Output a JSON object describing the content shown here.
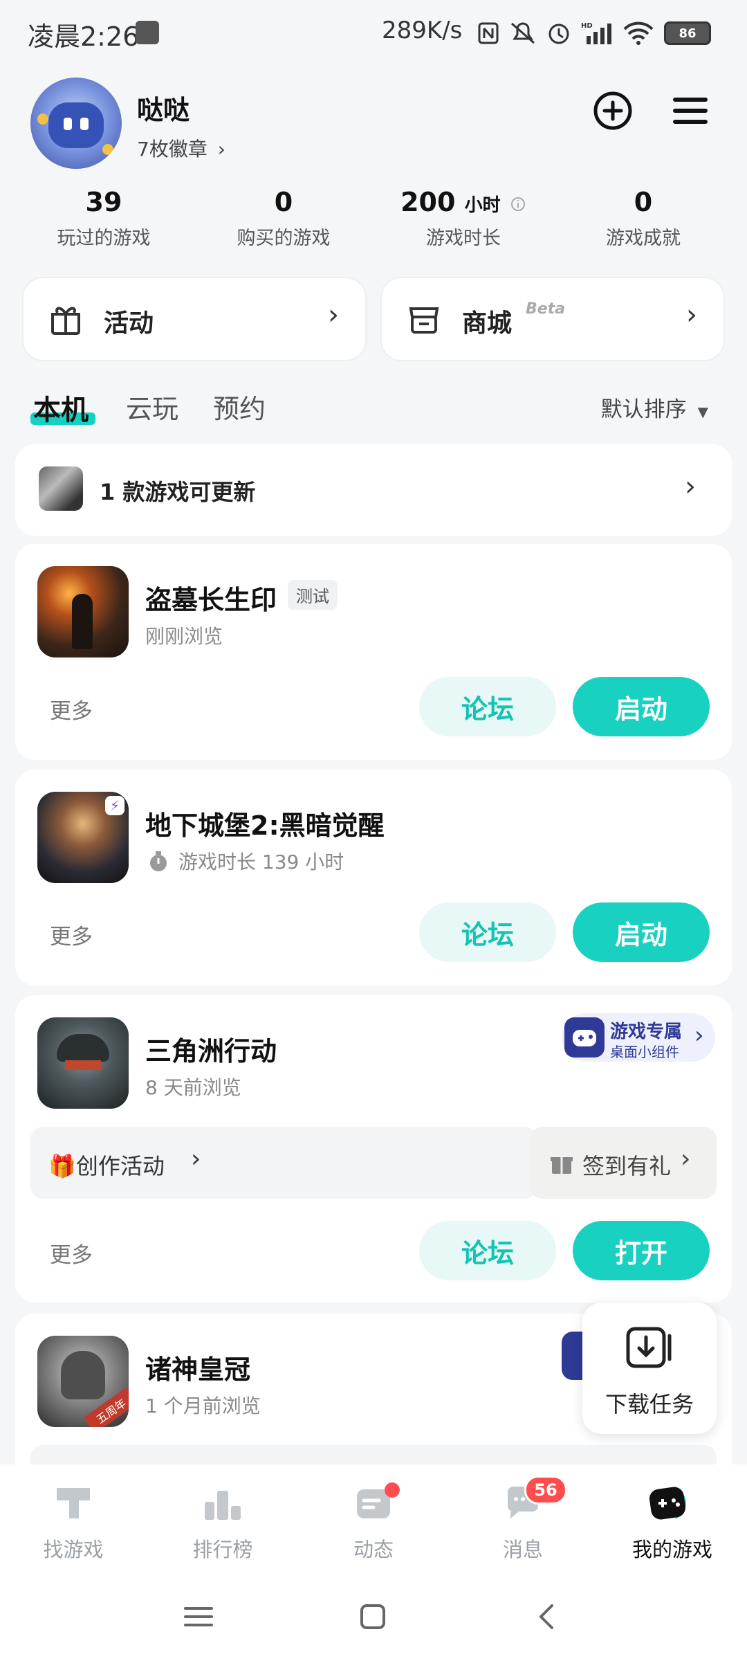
{
  "status_bar": {
    "time": "凌晨2:26",
    "net_speed": "289K/s",
    "battery": "86"
  },
  "profile": {
    "name": "哒哒",
    "badges": "7枚徽章",
    "badges_chevron": "›"
  },
  "stats": [
    {
      "value": "39",
      "unit": "",
      "label": "玩过的游戏"
    },
    {
      "value": "0",
      "unit": "",
      "label": "购买的游戏"
    },
    {
      "value": "200",
      "unit": "小时",
      "label": "游戏时长"
    },
    {
      "value": "0",
      "unit": "",
      "label": "游戏成就"
    }
  ],
  "quick_links": {
    "activity": "活动",
    "store": "商城",
    "store_tag": "Beta"
  },
  "tabs": {
    "local": "本机",
    "cloud": "云玩",
    "reserve": "预约",
    "sort": "默认排序"
  },
  "update_banner": {
    "text": "1 款游戏可更新"
  },
  "games": [
    {
      "title": "盗墓长生印",
      "tag": "测试",
      "sub": "刚刚浏览",
      "more": "更多",
      "forum": "论坛",
      "action": "启动"
    },
    {
      "title": "地下城堡2:黑暗觉醒",
      "sub": "游戏时长 139 小时",
      "more": "更多",
      "forum": "论坛",
      "action": "启动"
    },
    {
      "title": "三角洲行动",
      "sub": "8 天前浏览",
      "widget_title": "游戏专属",
      "widget_sub": "桌面小组件",
      "event": "🎁创作活动",
      "event_chevron": "›",
      "checkin": "签到有礼",
      "checkin_chevron": "›",
      "more": "更多",
      "forum": "论坛",
      "action": "打开"
    },
    {
      "title": "诸神皇冠",
      "sub": "1 个月前浏览",
      "icon_badge": "五周年"
    }
  ],
  "download_fab": {
    "label": "下载任务"
  },
  "bottom_nav": [
    {
      "label": "找游戏"
    },
    {
      "label": "排行榜"
    },
    {
      "label": "动态"
    },
    {
      "label": "消息",
      "badge": "56"
    },
    {
      "label": "我的游戏"
    }
  ],
  "colors": {
    "accent": "#18d1c0",
    "accent_light": "#e7f8f6",
    "badge_red": "#ff4d4f"
  }
}
